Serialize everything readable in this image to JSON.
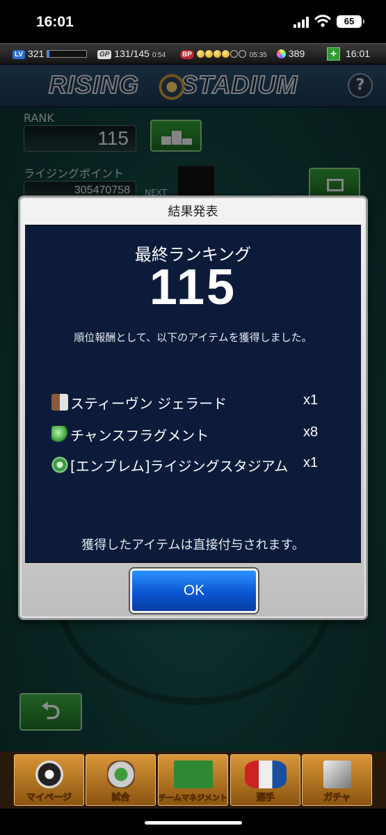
{
  "status_bar": {
    "time": "16:01",
    "battery": "65"
  },
  "game_bar": {
    "lv_tag": "LV",
    "lv": "321",
    "lv_progress": 0.05,
    "gp_tag": "GP",
    "gp": "131/145",
    "gp_timer": "0:54",
    "bp_tag": "BP",
    "bp_full": 4,
    "bp_total": 6,
    "bp_timer": "05:35",
    "gems": "389",
    "plus": "+",
    "clock": "16:01"
  },
  "header": {
    "logo_left": "RISING",
    "logo_right": "STADIUM",
    "help": "?"
  },
  "rank_section": {
    "label": "RANK",
    "value": "115"
  },
  "points_section": {
    "label": "ライジングポイント",
    "value": "305470758",
    "next": "NEXT"
  },
  "dialog": {
    "title": "結果発表",
    "final_ranking_label": "最終ランキング",
    "final_rank": "115",
    "description": "順位報酬として、以下のアイテムを獲得しました。",
    "rewards": [
      {
        "icon": "player-card-icon",
        "name": "スティーヴン ジェラード",
        "qty": "x1"
      },
      {
        "icon": "chance-fragment-icon",
        "name": "チャンスフラグメント",
        "qty": "x8"
      },
      {
        "icon": "emblem-icon",
        "name": "[エンブレム]ライジングスタジアム",
        "qty": "x1"
      }
    ],
    "note": "獲得したアイテムは直接付与されます。",
    "ok_label": "OK"
  },
  "back_button": "⮌",
  "bottom_nav": [
    {
      "label": "マイページ"
    },
    {
      "label": "試合"
    },
    {
      "label": "チームマネジメント"
    },
    {
      "label": "選手"
    },
    {
      "label": "ガチャ"
    }
  ]
}
